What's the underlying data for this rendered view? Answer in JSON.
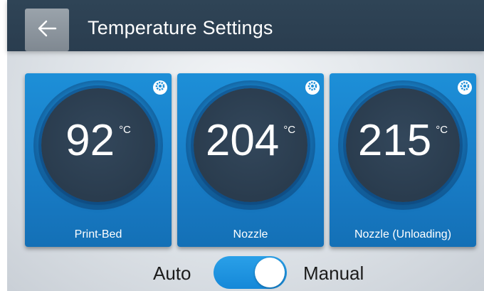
{
  "header": {
    "title": "Temperature Settings",
    "back_icon": "arrow-left-icon"
  },
  "cards": [
    {
      "value": "92",
      "unit": "°C",
      "label": "Print-Bed",
      "settings_icon": "gear-icon"
    },
    {
      "value": "204",
      "unit": "°C",
      "label": "Nozzle",
      "settings_icon": "gear-icon"
    },
    {
      "value": "215",
      "unit": "°C",
      "label": "Nozzle (Unloading)",
      "settings_icon": "gear-icon"
    }
  ],
  "mode_toggle": {
    "left_label": "Auto",
    "right_label": "Manual",
    "state": "Manual"
  },
  "colors": {
    "header": "#2f4456",
    "card": "#1d8fd8",
    "dial": "#2a3c4e",
    "toggle_on": "#1588d8"
  }
}
